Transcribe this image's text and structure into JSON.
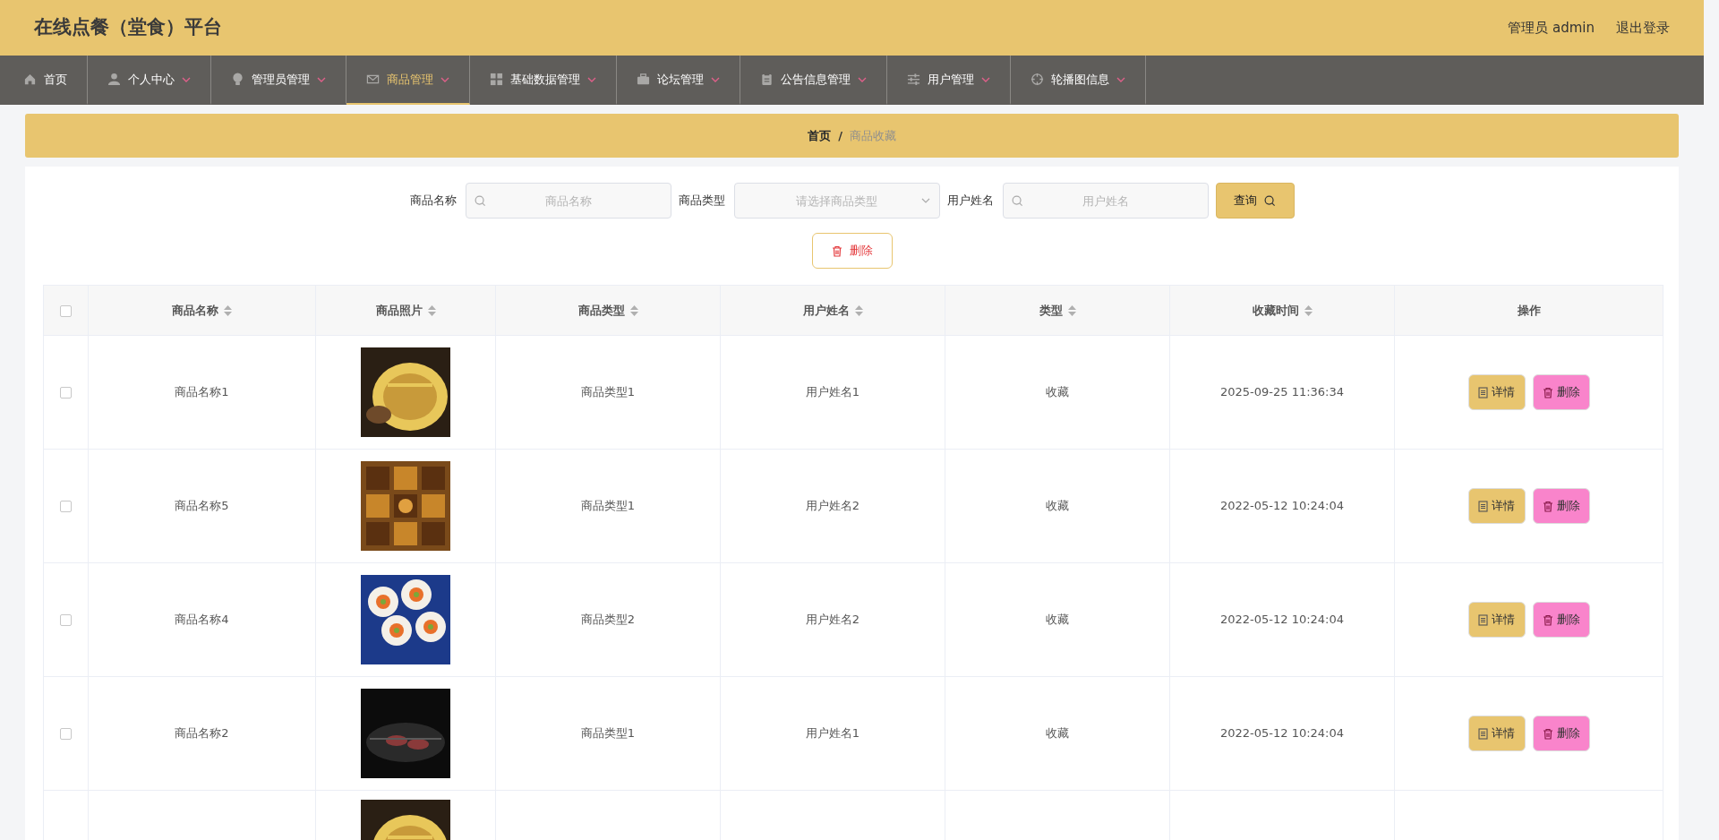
{
  "header": {
    "title": "在线点餐（堂食）平台",
    "user": "管理员 admin",
    "logout": "退出登录"
  },
  "nav": [
    {
      "label": "首页",
      "dropdown": false,
      "selected": false
    },
    {
      "label": "个人中心",
      "dropdown": true,
      "selected": false
    },
    {
      "label": "管理员管理",
      "dropdown": true,
      "selected": false
    },
    {
      "label": "商品管理",
      "dropdown": true,
      "selected": true
    },
    {
      "label": "基础数据管理",
      "dropdown": true,
      "selected": false
    },
    {
      "label": "论坛管理",
      "dropdown": true,
      "selected": false
    },
    {
      "label": "公告信息管理",
      "dropdown": true,
      "selected": false
    },
    {
      "label": "用户管理",
      "dropdown": true,
      "selected": false
    },
    {
      "label": "轮播图信息",
      "dropdown": true,
      "selected": false
    }
  ],
  "breadcrumb": {
    "items": [
      "首页",
      "商品收藏"
    ],
    "separator": "/"
  },
  "search": {
    "fields": [
      {
        "label": "商品名称",
        "kind": "text",
        "placeholder": "商品名称"
      },
      {
        "label": "商品类型",
        "kind": "select",
        "placeholder": "请选择商品类型"
      },
      {
        "label": "用户姓名",
        "kind": "text",
        "placeholder": "用户姓名"
      }
    ],
    "button": "查询"
  },
  "bulk_delete": "删除",
  "table": {
    "select_all_checked": false,
    "columns": [
      {
        "label": "商品名称",
        "sortable": true
      },
      {
        "label": "商品照片",
        "sortable": true
      },
      {
        "label": "商品类型",
        "sortable": true
      },
      {
        "label": "用户姓名",
        "sortable": true
      },
      {
        "label": "类型",
        "sortable": true
      },
      {
        "label": "收藏时间",
        "sortable": true
      },
      {
        "label": "操作",
        "sortable": false
      }
    ],
    "rows": [
      {
        "checked": false,
        "name": "商品名称1",
        "photo": {
          "kind": "picture"
        },
        "category": "商品类型1",
        "user": "用户姓名1",
        "type": "收藏",
        "time": "2025-09-25 11:36:34",
        "actions": [
          "详情",
          "删除"
        ]
      },
      {
        "checked": false,
        "name": "商品名称5",
        "photo": {
          "kind": "picture"
        },
        "category": "商品类型1",
        "user": "用户姓名2",
        "type": "收藏",
        "time": "2022-05-12 10:24:04",
        "actions": [
          "详情",
          "删除"
        ]
      },
      {
        "checked": false,
        "name": "商品名称4",
        "photo": {
          "kind": "picture"
        },
        "category": "商品类型2",
        "user": "用户姓名2",
        "type": "收藏",
        "time": "2022-05-12 10:24:04",
        "actions": [
          "详情",
          "删除"
        ]
      },
      {
        "checked": false,
        "name": "商品名称2",
        "photo": {
          "kind": "picture"
        },
        "category": "商品类型1",
        "user": "用户姓名1",
        "type": "收藏",
        "time": "2022-05-12 10:24:04",
        "actions": [
          "详情",
          "删除"
        ]
      },
      {
        "photo": {
          "kind": "picture"
        }
      }
    ]
  }
}
